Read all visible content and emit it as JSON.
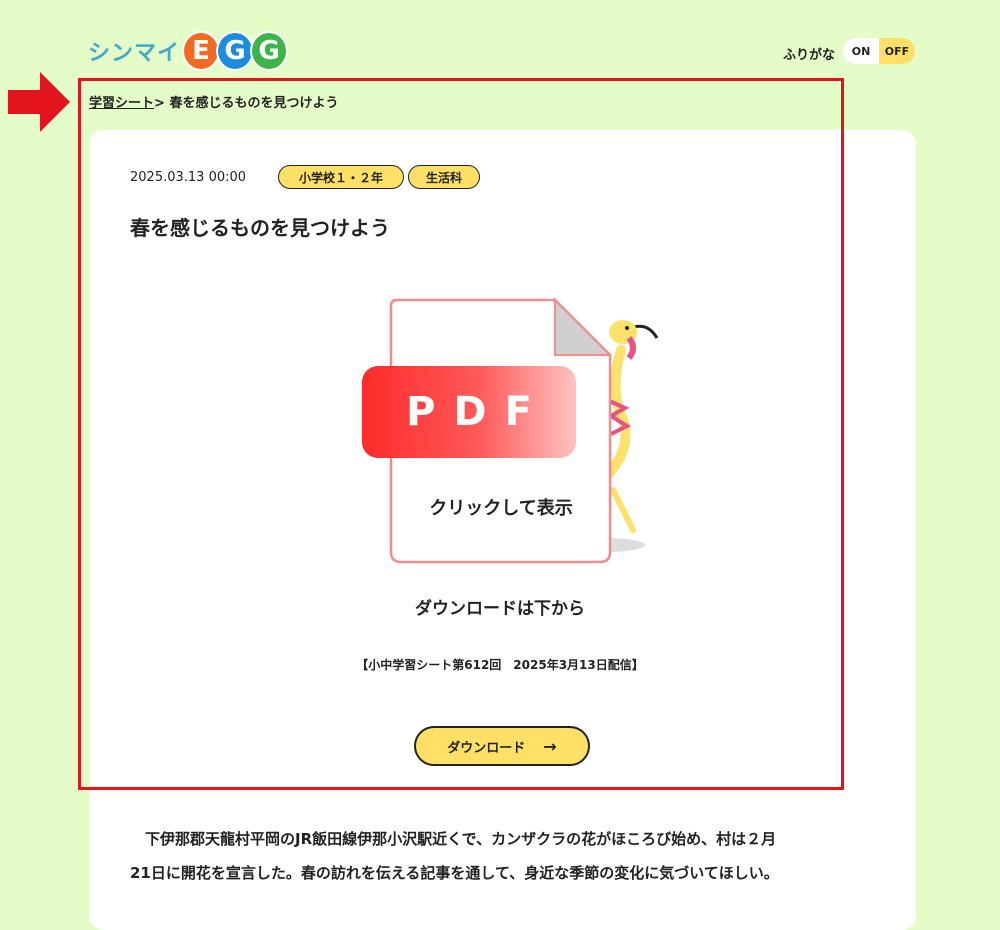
{
  "header": {
    "logo_text": "シンマイ",
    "logo_egg": [
      "E",
      "G",
      "G"
    ],
    "furigana_label": "ふりがな",
    "toggle_on": "ON",
    "toggle_off": "OFF"
  },
  "breadcrumb": {
    "parent": "学習シート",
    "separator": ">",
    "current": "春を感じるものを見つけよう"
  },
  "article": {
    "date": "2025.03.13 00:00",
    "tags": [
      "小学校１・２年",
      "生活科"
    ],
    "title": "春を感じるものを見つけよう",
    "pdf_label": "PDF",
    "pdf_click": "クリックして表示",
    "download_below": "ダウンロードは下から",
    "issue": "【小中学習シート第612回　2025年3月13日配信】",
    "download_button": "ダウンロード",
    "body_line1": "下伊那郡天龍村平岡のJR飯田線伊那小沢駅近くで、カンザクラの花がほころび始め、村は２月",
    "body_line2": "21日に開花を宣言した。春の訪れを伝える記事を通して、身近な季節の変化に気づいてほしい。"
  },
  "colors": {
    "background": "#e4fcc8",
    "accent_yellow": "#ffe066",
    "annotation_red": "#e3141d",
    "pdf_red": "#ff3b3b"
  }
}
